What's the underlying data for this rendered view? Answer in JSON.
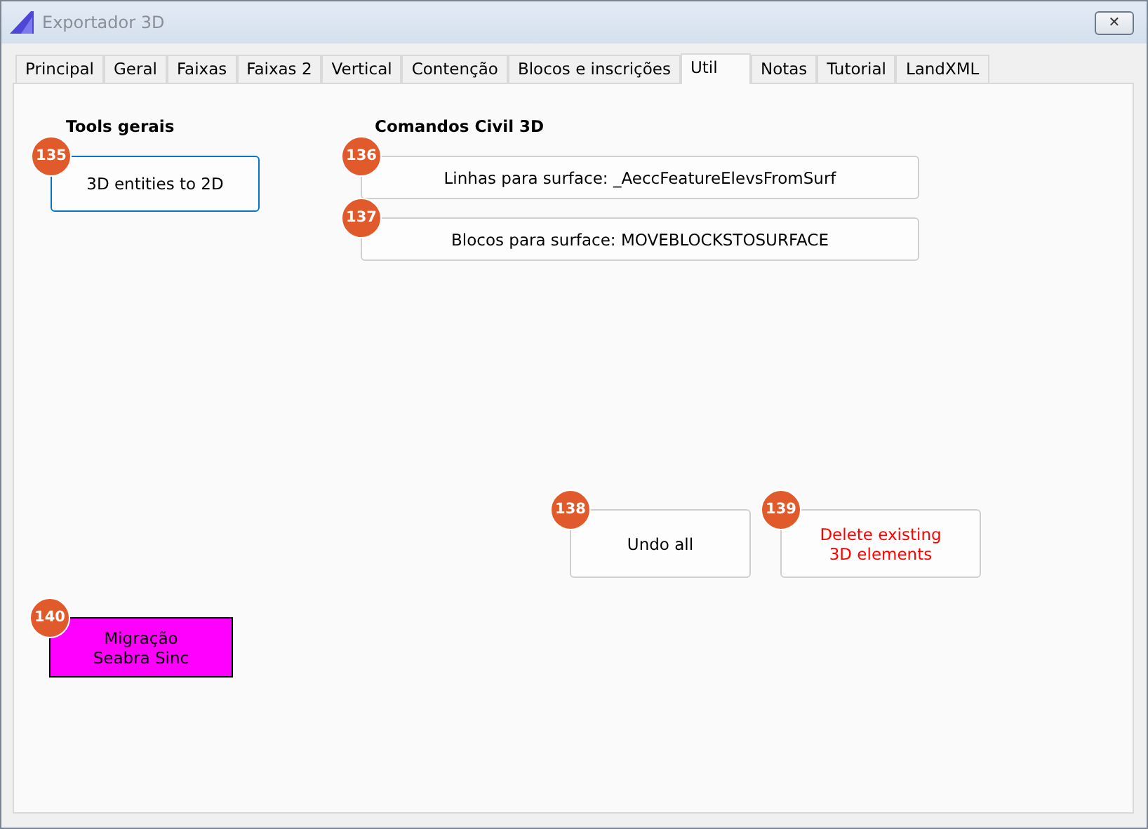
{
  "window": {
    "title": "Exportador 3D",
    "close": "✕"
  },
  "tabs": [
    {
      "label": "Principal",
      "selected": false
    },
    {
      "label": "Geral",
      "selected": false
    },
    {
      "label": "Faixas",
      "selected": false
    },
    {
      "label": "Faixas 2",
      "selected": false
    },
    {
      "label": "Vertical",
      "selected": false
    },
    {
      "label": "Contenção",
      "selected": false
    },
    {
      "label": "Blocos e inscrições",
      "selected": false
    },
    {
      "label": "Util",
      "selected": true
    },
    {
      "label": "Notas",
      "selected": false
    },
    {
      "label": "Tutorial",
      "selected": false
    },
    {
      "label": "LandXML",
      "selected": false
    }
  ],
  "groups": [
    {
      "title": "Tools gerais",
      "buttons": [
        {
          "badge": "135",
          "label": "3D entities to 2D",
          "kind": "focused"
        }
      ]
    },
    {
      "title": "Comandos Civil 3D",
      "buttons": [
        {
          "badge": "136",
          "label": "Linhas para surface: _AeccFeatureElevsFromSurf",
          "kind": "normal"
        },
        {
          "badge": "137",
          "label": "Blocos para surface: MOVEBLOCKSTOSURFACE",
          "kind": "normal"
        }
      ]
    }
  ],
  "actions": [
    {
      "badge": "138",
      "label": "Undo all",
      "kind": "normal"
    },
    {
      "badge": "139",
      "label": "Delete existing\n3D elements",
      "kind": "danger"
    }
  ],
  "migration": {
    "badge": "140",
    "label": "Migração\nSeabra Sinc",
    "kind": "magenta"
  }
}
